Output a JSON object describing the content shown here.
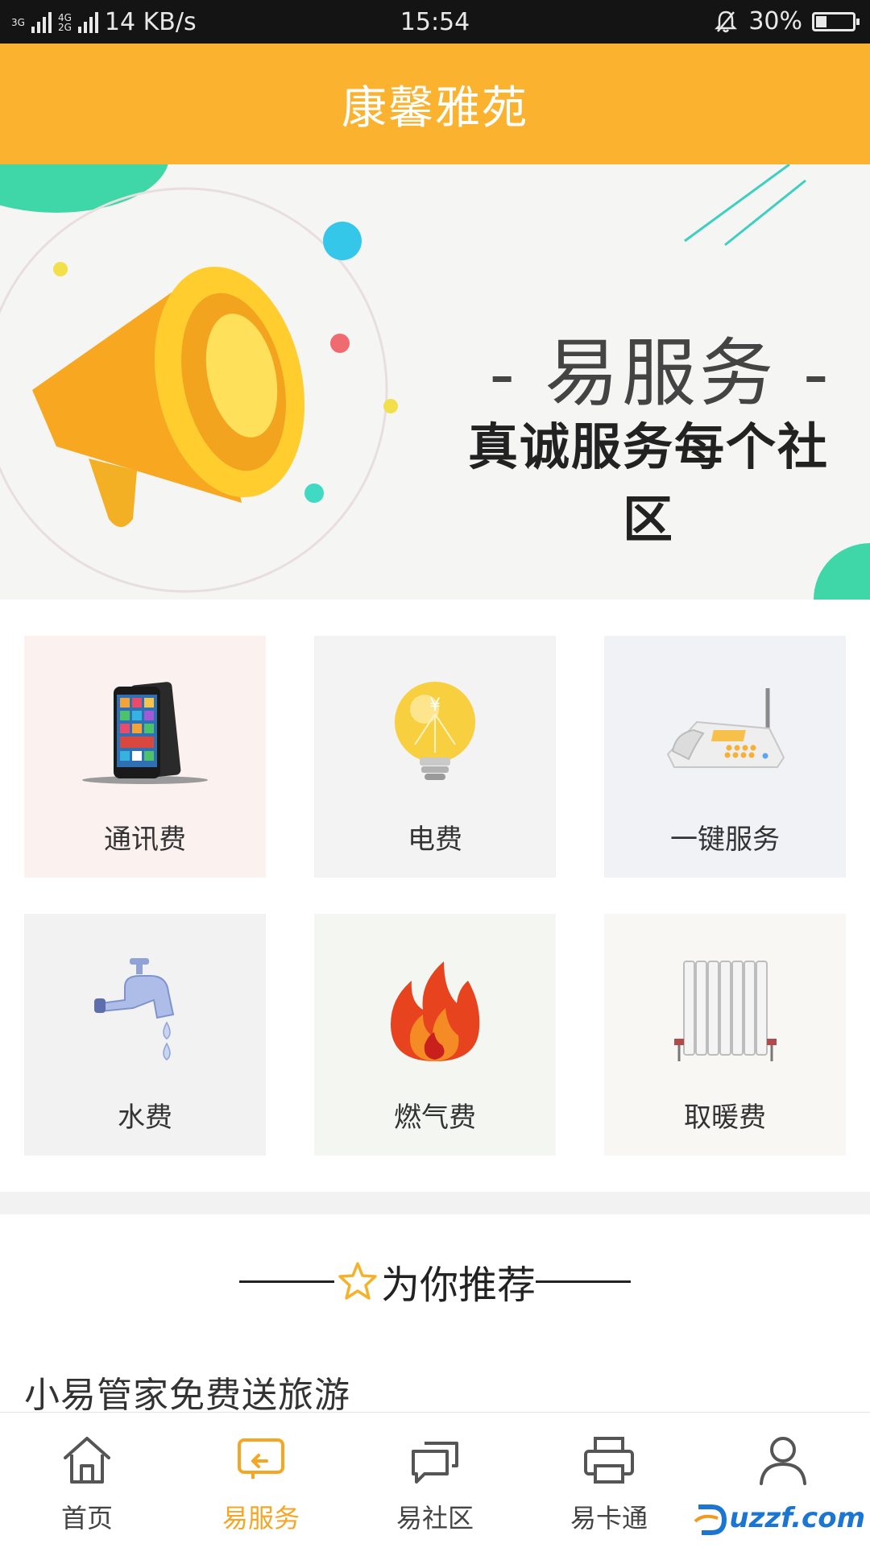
{
  "status_bar": {
    "network_top": "3G",
    "network_mid": "4G",
    "network_bot": "2G",
    "speed": "14 KB/s",
    "time": "15:54",
    "battery_text": "30%",
    "battery_level": 0.3,
    "icons": [
      "signal-icon",
      "mute-icon",
      "battery-icon"
    ]
  },
  "header": {
    "title": "康馨雅苑"
  },
  "banner": {
    "headline": "- 易服务 -",
    "tagline": "真诚服务每个社区"
  },
  "services": [
    {
      "label": "通讯费",
      "icon": "mobile-phone-icon",
      "bg": "#fbf1ef"
    },
    {
      "label": "电费",
      "icon": "lightbulb-icon",
      "bg": "#f3f3f3"
    },
    {
      "label": "一键服务",
      "icon": "telephone-icon",
      "bg": "#f0f2f5"
    },
    {
      "label": "水费",
      "icon": "water-tap-icon",
      "bg": "#f2f2f2"
    },
    {
      "label": "燃气费",
      "icon": "flame-icon",
      "bg": "#f3f6f1"
    },
    {
      "label": "取暖费",
      "icon": "radiator-icon",
      "bg": "#f8f7f3"
    }
  ],
  "recommend": {
    "title": "为你推荐",
    "icon": "star-icon"
  },
  "list": {
    "first_item": "小易管家免费送旅游"
  },
  "tabbar": {
    "items": [
      {
        "label": "首页",
        "icon": "home-icon"
      },
      {
        "label": "易服务",
        "icon": "service-icon",
        "active": true
      },
      {
        "label": "易社区",
        "icon": "chat-icon"
      },
      {
        "label": "易卡通",
        "icon": "printer-icon"
      },
      {
        "label": "",
        "icon": "user-icon"
      }
    ]
  },
  "colors": {
    "accent": "#fbb22f",
    "active_tab": "#f6a623"
  },
  "watermark": {
    "text": "uzzf.com",
    "icon": "watermark-logo-icon"
  }
}
